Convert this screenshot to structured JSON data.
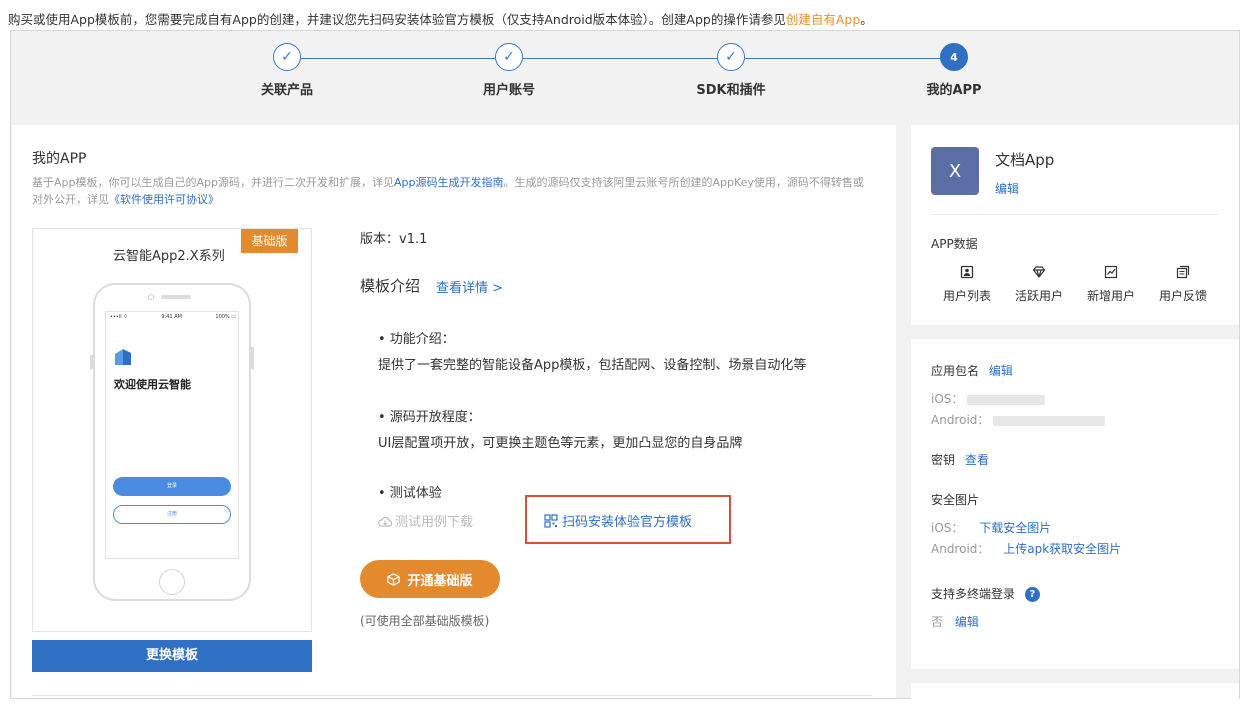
{
  "notice": {
    "text": "购买或使用App模板前，您需要完成自有App的创建，并建议您先扫码安装体验官方模板（仅支持Android版本体验）。创建App的操作请参见",
    "link": "创建自有App",
    "end": "。"
  },
  "steps": [
    {
      "label": "关联产品",
      "state": "done",
      "icon": "check-icon"
    },
    {
      "label": "用户账号",
      "state": "done",
      "icon": "check-icon"
    },
    {
      "label": "SDK和插件",
      "state": "done",
      "icon": "check-icon"
    },
    {
      "label": "我的APP",
      "state": "active",
      "number": "4"
    }
  ],
  "main": {
    "title": "我的APP",
    "desc_1": "基于App模板，你可以生成自己的App源码，并进行二次开发和扩展，详见",
    "desc_link_1": "App源码生成开发指南",
    "desc_2": "。生成的源码仅支持该阿里云账号所创建的AppKey使用，源码不得转售或对外公开，详见",
    "desc_link_2": "《软件使用许可协议》",
    "template_name": "云智能App2.X系列",
    "badge": "基础版",
    "phone": {
      "status_left": "•••ll ⌔",
      "status_mid": "9:41 AM",
      "status_right": "100% ▭",
      "welcome": "欢迎使用云智能",
      "login": "登录",
      "register": "注册"
    },
    "change_button": "更换模板",
    "version": "版本：v1.1",
    "intro_title": "模板介绍",
    "intro_link": "查看详情 >",
    "features": [
      {
        "heading": "• 功能介绍：",
        "text": "提供了一套完整的智能设备App模板，包括配网、设备控制、场景自动化等"
      },
      {
        "heading": "• 源码开放程度：",
        "text": "UI层配置项开放，可更换主题色等元素，更加凸显您的自身品牌"
      },
      {
        "heading": "• 测试体验",
        "text": ""
      }
    ],
    "download_label": "测试用例下载",
    "scan_label": "扫码安装体验官方模板",
    "open_button": "开通基础版",
    "open_note": "(可使用全部基础版模板)"
  },
  "app": {
    "avatar_letter": "X",
    "name": "文档App",
    "edit": "编辑",
    "data_title": "APP数据",
    "data_items": [
      {
        "label": "用户列表",
        "icon": "user-list-icon"
      },
      {
        "label": "活跃用户",
        "icon": "diamond-icon"
      },
      {
        "label": "新增用户",
        "icon": "chart-icon"
      },
      {
        "label": "用户反馈",
        "icon": "feedback-icon"
      }
    ]
  },
  "settings": {
    "package_label": "应用包名",
    "package_edit": "编辑",
    "ios_label": "iOS：",
    "android_label": "Android：",
    "secret_label": "密钥",
    "secret_view": "查看",
    "security_image_label": "安全图片",
    "security_ios_label": "iOS：",
    "security_ios_link": "下载安全图片",
    "security_android_label": "Android：",
    "security_android_link": "上传apk获取安全图片",
    "multi_login_label": "支持多终端登录",
    "help_glyph": "?",
    "multi_login_value": "否",
    "multi_login_edit": "编辑"
  },
  "colors": {
    "primary": "#2f6fc4",
    "accent_orange": "#e38a2e",
    "highlight_red": "#d9503a"
  }
}
